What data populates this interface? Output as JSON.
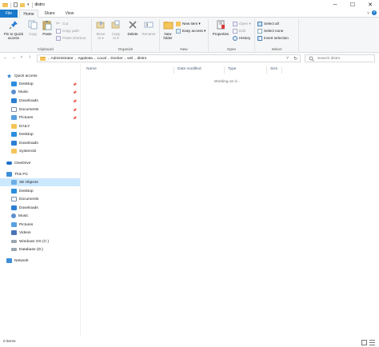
{
  "window": {
    "title": "distro",
    "controls": {
      "minimize": "─",
      "maximize": "☐",
      "close": "✕"
    }
  },
  "ribbon_tabs": [
    {
      "label": "File"
    },
    {
      "label": "Home"
    },
    {
      "label": "Share"
    },
    {
      "label": "View"
    }
  ],
  "ribbon": {
    "clipboard": {
      "group_label": "Clipboard",
      "pin_line1": "Pin to Quick",
      "pin_line2": "access",
      "copy": "Copy",
      "paste": "Paste",
      "cut": "Cut",
      "copy_path": "Copy path",
      "paste_shortcut": "Paste shortcut"
    },
    "organize": {
      "group_label": "Organize",
      "move_line1": "Move",
      "move_line2": "to ▾",
      "copy_line1": "Copy",
      "copy_line2": "to ▾",
      "delete": "Delete",
      "rename": "Rename"
    },
    "new": {
      "group_label": "New",
      "new_folder_line1": "New",
      "new_folder_line2": "folder",
      "new_item": "New item ▾",
      "easy_access": "Easy access ▾"
    },
    "open": {
      "group_label": "Open",
      "properties": "Properties",
      "open": "Open ▾",
      "edit": "Edit",
      "history": "History"
    },
    "select": {
      "group_label": "Select",
      "select_all": "Select all",
      "select_none": "Select none",
      "invert_selection": "Invert selection"
    }
  },
  "navigation": {
    "back": "←",
    "forward": "→",
    "recent": "˅",
    "up": "↑",
    "breadcrumbs": [
      "Administrator",
      "AppData",
      "Local",
      "Docker",
      "wsl",
      "distro"
    ],
    "refresh": "↻",
    "search_placeholder": "Search distro"
  },
  "sidebar": {
    "quick_access": {
      "label": "Quick access",
      "items": [
        {
          "label": "Desktop",
          "pinned": true
        },
        {
          "label": "Music",
          "pinned": true
        },
        {
          "label": "Downloads",
          "pinned": true
        },
        {
          "label": "Documents",
          "pinned": true
        },
        {
          "label": "Pictures",
          "pinned": true
        },
        {
          "label": "DAILY",
          "pinned": false
        },
        {
          "label": "Desktop",
          "pinned": false
        },
        {
          "label": "Downloads",
          "pinned": false
        },
        {
          "label": "System32",
          "pinned": false
        }
      ]
    },
    "onedrive": {
      "label": "OneDrive"
    },
    "this_pc": {
      "label": "This PC",
      "items": [
        {
          "label": "3D Objects",
          "selected": true
        },
        {
          "label": "Desktop"
        },
        {
          "label": "Documents"
        },
        {
          "label": "Downloads"
        },
        {
          "label": "Music"
        },
        {
          "label": "Pictures"
        },
        {
          "label": "Videos"
        },
        {
          "label": "Windows OS (C:)"
        },
        {
          "label": "Database (D:)"
        }
      ]
    },
    "network": {
      "label": "Network"
    }
  },
  "file_list": {
    "columns": [
      "Name",
      "Date modified",
      "Type",
      "Size"
    ],
    "empty_message": "Working on it..."
  },
  "status": {
    "item_count": "0 items"
  },
  "colors": {
    "file_tab": "#1979ca",
    "selection": "#cce8ff",
    "folder": "#f4c55a"
  }
}
